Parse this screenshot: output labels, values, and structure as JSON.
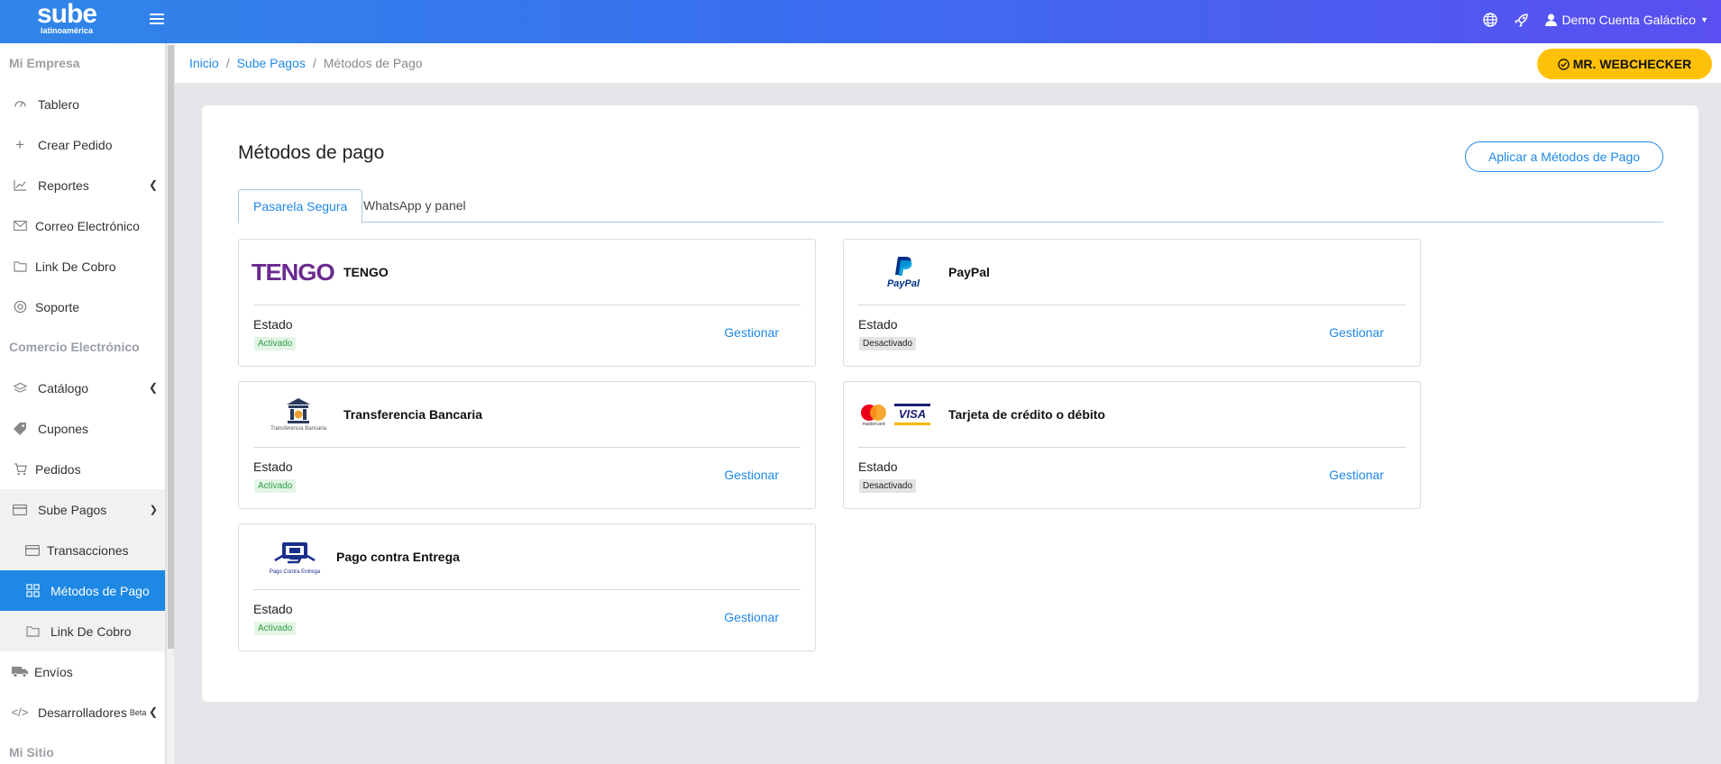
{
  "topbar": {
    "logo_main": "sube",
    "logo_sub": "latinoamérica",
    "user_name": "Demo Cuenta Galáctico",
    "icons": [
      "globe-icon",
      "rocket-icon",
      "user-icon"
    ]
  },
  "sidebar": {
    "sections": {
      "empresa": "Mi Empresa",
      "comercio": "Comercio Electrónico",
      "sitio": "Mi Sitio"
    },
    "items": {
      "tablero": "Tablero",
      "crear": "Crear Pedido",
      "reportes": "Reportes",
      "correo": "Correo Electrónico",
      "link1": "Link De Cobro",
      "soporte": "Soporte",
      "catalogo": "Catálogo",
      "cupones": "Cupones",
      "pedidos": "Pedidos",
      "subepagos": "Sube Pagos",
      "transacciones": "Transacciones",
      "metodos": "Métodos de Pago",
      "link2": "Link De Cobro",
      "envios": "Envíos",
      "dev": "Desarrolladores",
      "dev_badge": "Beta"
    }
  },
  "breadcrumb": {
    "inicio": "Inicio",
    "sube": "Sube Pagos",
    "current": "Métodos de Pago",
    "sep": "/"
  },
  "webchecker": "MR. WEBCHECKER",
  "page": {
    "title": "Métodos de pago",
    "apply_button": "Aplicar a Métodos de Pago",
    "tabs": [
      "Pasarela Segura",
      "WhatsApp y panel"
    ],
    "estado_label": "Estado",
    "manage_label": "Gestionar"
  },
  "methods": [
    {
      "name": "TENGO",
      "logo_text": "TENGO",
      "status": "Activado"
    },
    {
      "name": "PayPal",
      "logo_text": "PayPal",
      "status": "Desactivado"
    },
    {
      "name": "Transferencia Bancaria",
      "logo_text": "Transferencia Bancaria",
      "status": "Activado"
    },
    {
      "name": "Tarjeta de crédito o débito",
      "logo_text": "VISA",
      "logo_text2": "mastercard",
      "status": "Desactivado"
    },
    {
      "name": "Pago contra Entrega",
      "logo_text": "Pago Contra Entrega",
      "status": "Activado"
    }
  ],
  "colors": {
    "accent": "#1e88e5",
    "active_badge": "#2e9d45",
    "webchecker": "#ffc107"
  }
}
